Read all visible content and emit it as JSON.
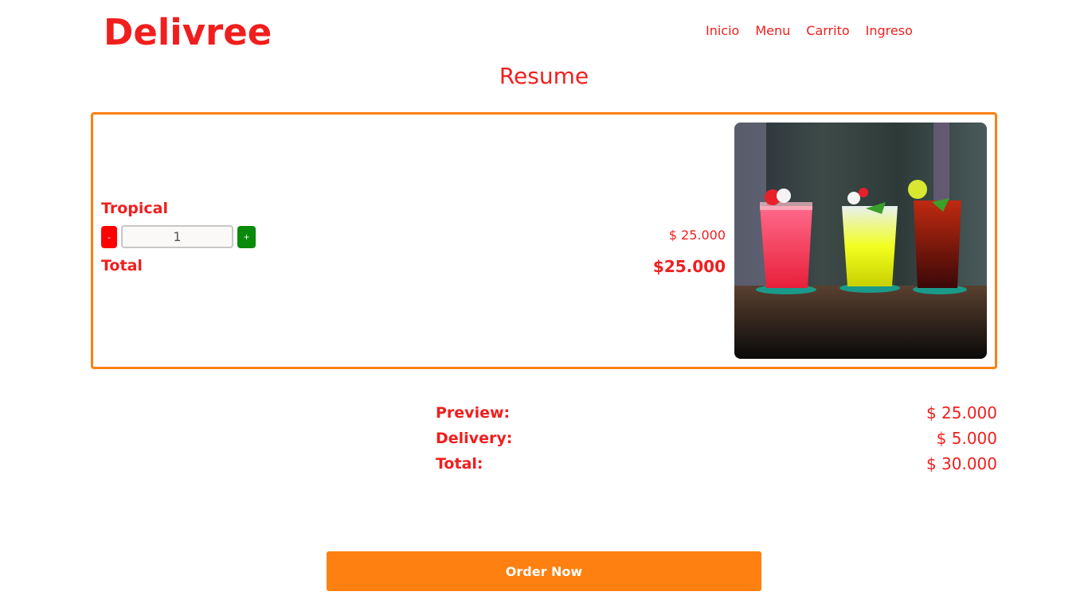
{
  "brand": "Delivree",
  "nav": [
    "Inicio",
    "Menu",
    "Carrito",
    "Ingreso"
  ],
  "page_title": "Resume",
  "item": {
    "name": "Tropical",
    "minus_label": "-",
    "plus_label": "+",
    "quantity": "1",
    "price": "$ 25.000",
    "total_label": "Total",
    "total_value": "$25.000",
    "image_icon": "cocktail-drinks-photo"
  },
  "summary": {
    "preview_label": "Preview:",
    "preview_value": "$ 25.000",
    "delivery_label": "Delivery:",
    "delivery_value": "$ 5.000",
    "total_label": "Total:",
    "total_value": "$ 30.000"
  },
  "order_button": "Order Now",
  "colors": {
    "primary_red": "#f11e1e",
    "accent_orange": "#fd8010",
    "minus_red": "#ff0000",
    "plus_green": "#0a8a0a"
  }
}
